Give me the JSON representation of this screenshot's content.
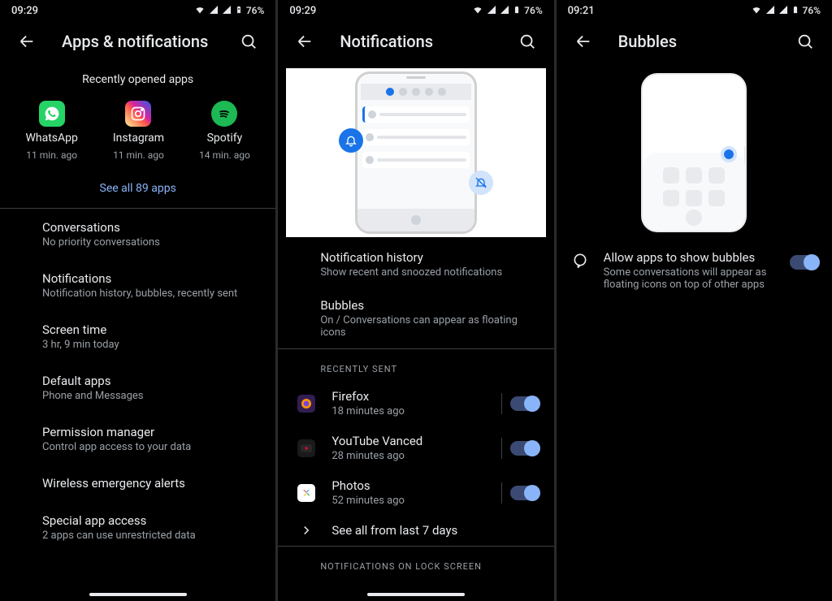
{
  "status": {
    "time_a": "09:29",
    "time_b": "09:29",
    "time_c": "09:21",
    "battery": "76%"
  },
  "screen1": {
    "title": "Apps & notifications",
    "recent_header": "Recently opened apps",
    "apps": [
      {
        "name": "WhatsApp",
        "time": "11 min. ago"
      },
      {
        "name": "Instagram",
        "time": "11 min. ago"
      },
      {
        "name": "Spotify",
        "time": "14 min. ago"
      }
    ],
    "see_all": "See all 89 apps",
    "items": [
      {
        "title": "Conversations",
        "sub": "No priority conversations"
      },
      {
        "title": "Notifications",
        "sub": "Notification history, bubbles, recently sent"
      },
      {
        "title": "Screen time",
        "sub": "3 hr, 9 min today"
      },
      {
        "title": "Default apps",
        "sub": "Phone and Messages"
      },
      {
        "title": "Permission manager",
        "sub": "Control app access to your data"
      },
      {
        "title": "Wireless emergency alerts",
        "sub": ""
      },
      {
        "title": "Special app access",
        "sub": "2 apps can use unrestricted data"
      }
    ]
  },
  "screen2": {
    "title": "Notifications",
    "items": [
      {
        "title": "Notification history",
        "sub": "Show recent and snoozed notifications"
      },
      {
        "title": "Bubbles",
        "sub": "On / Conversations can appear as floating icons"
      }
    ],
    "recent_label": "RECENTLY SENT",
    "recent": [
      {
        "name": "Firefox",
        "time": "18 minutes ago"
      },
      {
        "name": "YouTube Vanced",
        "time": "28 minutes ago"
      },
      {
        "name": "Photos",
        "time": "52 minutes ago"
      }
    ],
    "see_all": "See all from last 7 days",
    "lock_label": "NOTIFICATIONS ON LOCK SCREEN"
  },
  "screen3": {
    "title": "Bubbles",
    "item": {
      "title": "Allow apps to show bubbles",
      "sub": "Some conversations will appear as floating icons on top of other apps"
    }
  }
}
